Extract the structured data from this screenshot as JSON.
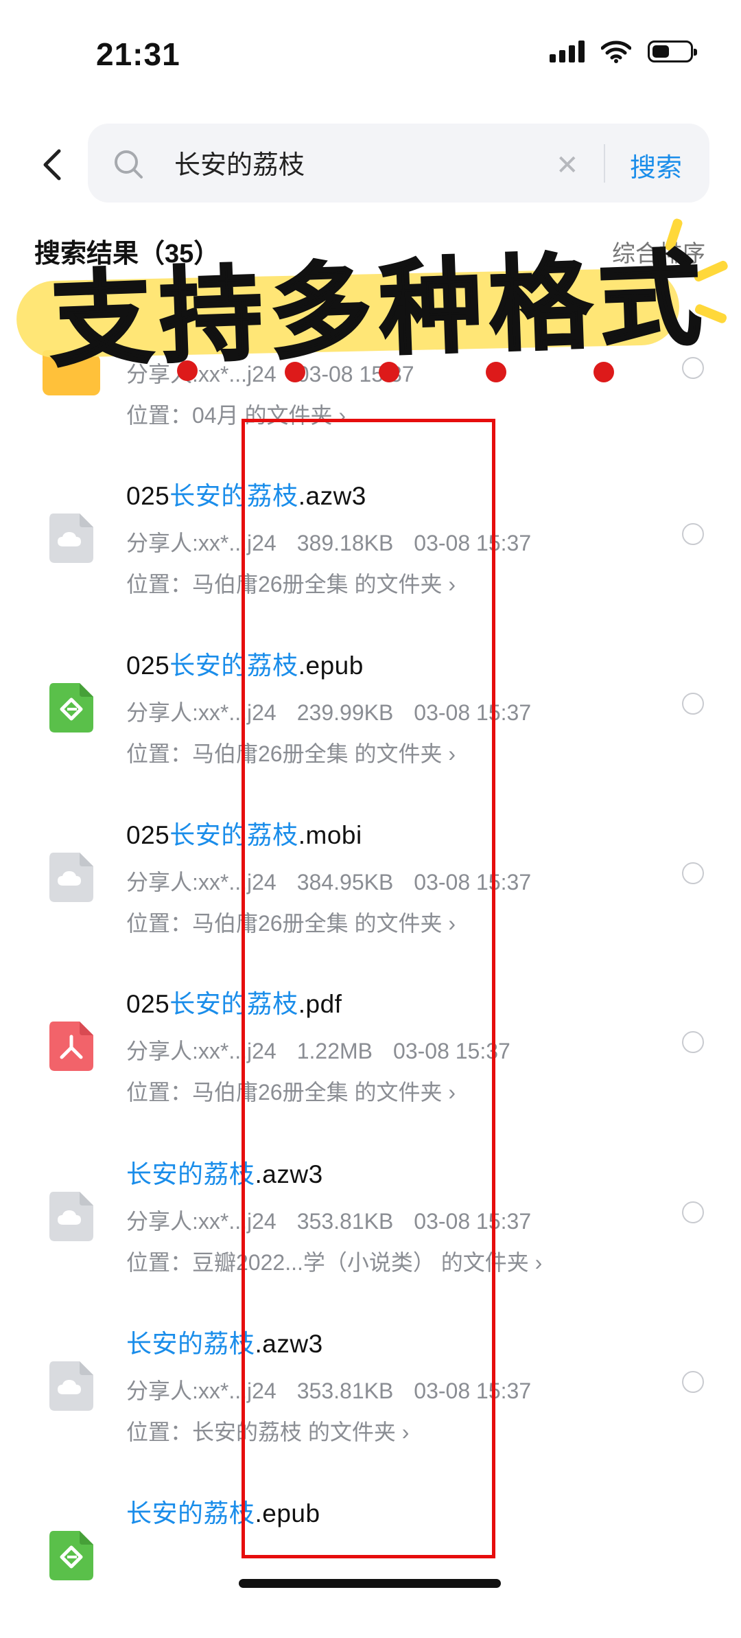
{
  "status": {
    "time": "21:31"
  },
  "search": {
    "query": "长安的荔枝",
    "button": "搜索"
  },
  "results": {
    "header": "搜索结果（35）",
    "sort": "综合排序"
  },
  "banner": {
    "text": "支持多种格式"
  },
  "colors": {
    "accent": "#1a8dea",
    "highlight_box": "#e60d0d",
    "banner": "#ffe46a"
  },
  "files": [
    {
      "icon": "folder-icon",
      "name_prefix": "",
      "name_highlight": "",
      "name_suffix": "",
      "sharer": "分享人:xx*...j24",
      "size": "",
      "date": "03-08 15:37",
      "location": "位置：04月 的文件夹 ›"
    },
    {
      "icon": "cloud-file-icon",
      "name_prefix": "025",
      "name_highlight": "长安的荔枝",
      "name_suffix": ".azw3",
      "sharer": "分享人:xx*...j24",
      "size": "389.18KB",
      "date": "03-08 15:37",
      "location": "位置：马伯庸26册全集 的文件夹 ›"
    },
    {
      "icon": "epub-icon",
      "name_prefix": "025",
      "name_highlight": "长安的荔枝",
      "name_suffix": ".epub",
      "sharer": "分享人:xx*...j24",
      "size": "239.99KB",
      "date": "03-08 15:37",
      "location": "位置：马伯庸26册全集 的文件夹 ›"
    },
    {
      "icon": "cloud-file-icon",
      "name_prefix": "025",
      "name_highlight": "长安的荔枝",
      "name_suffix": ".mobi",
      "sharer": "分享人:xx*...j24",
      "size": "384.95KB",
      "date": "03-08 15:37",
      "location": "位置：马伯庸26册全集 的文件夹 ›"
    },
    {
      "icon": "pdf-icon",
      "name_prefix": "025",
      "name_highlight": "长安的荔枝",
      "name_suffix": ".pdf",
      "sharer": "分享人:xx*...j24",
      "size": "1.22MB",
      "date": "03-08 15:37",
      "location": "位置：马伯庸26册全集 的文件夹 ›"
    },
    {
      "icon": "cloud-file-icon",
      "name_prefix": "",
      "name_highlight": "长安的荔枝",
      "name_suffix": ".azw3",
      "sharer": "分享人:xx*...j24",
      "size": "353.81KB",
      "date": "03-08 15:37",
      "location": "位置：豆瓣2022...学（小说类） 的文件夹 ›"
    },
    {
      "icon": "cloud-file-icon",
      "name_prefix": "",
      "name_highlight": "长安的荔枝",
      "name_suffix": ".azw3",
      "sharer": "分享人:xx*...j24",
      "size": "353.81KB",
      "date": "03-08 15:37",
      "location": "位置：长安的荔枝 的文件夹 ›"
    },
    {
      "icon": "epub-icon",
      "name_prefix": "",
      "name_highlight": "长安的荔枝",
      "name_suffix": ".epub",
      "sharer": "",
      "size": "",
      "date": "",
      "location": ""
    }
  ]
}
